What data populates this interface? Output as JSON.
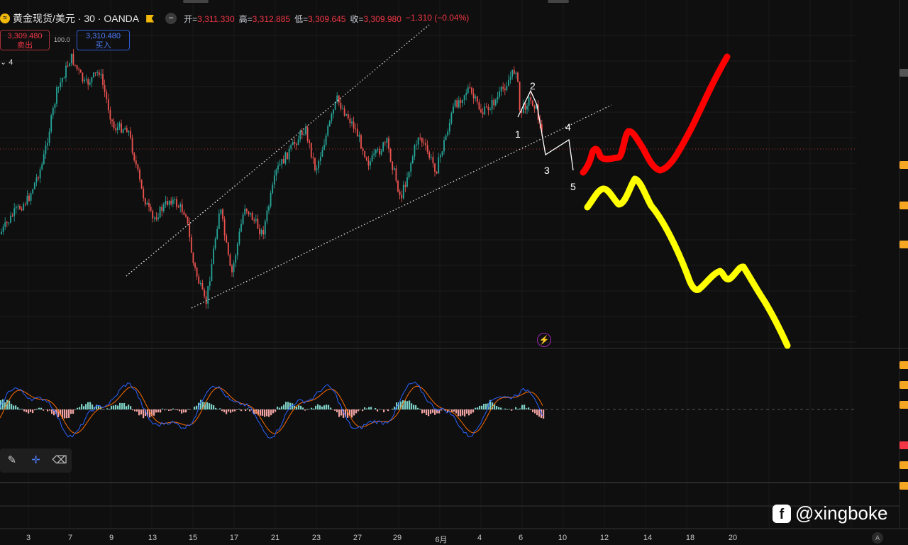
{
  "header": {
    "symbol_title": "黄金现货/美元 · 30 · OANDA",
    "collapse_label": "−",
    "ohlc": [
      {
        "label": "开=",
        "value": "3,311.330"
      },
      {
        "label": "高=",
        "value": "3,312.885"
      },
      {
        "label": "低=",
        "value": "3,309.645"
      },
      {
        "label": "收=",
        "value": "3,309.980"
      },
      {
        "label": "",
        "value": "−1.310 (−0.04%)"
      }
    ]
  },
  "trade": {
    "sell_price": "3,309.480",
    "sell_label": "卖出",
    "spread": "100.0",
    "buy_price": "3,310.480",
    "buy_label": "买入"
  },
  "indicator_toggle": "⌄ 4",
  "wave_labels": [
    "1",
    "2",
    "3",
    "4",
    "5"
  ],
  "x_axis_labels": [
    "3",
    "7",
    "9",
    "13",
    "15",
    "17",
    "21",
    "23",
    "27",
    "29",
    "6月",
    "4",
    "6",
    "10",
    "12",
    "14",
    "18",
    "20"
  ],
  "auto_button": "A",
  "watermark": "@xingboke",
  "colors": {
    "background": "#0f0f0f",
    "up_candle": "#26a69a",
    "down_candle": "#ef5350",
    "bullish_path": "#ff0000",
    "bearish_path": "#ffff00",
    "macd_line": "#2962ff",
    "signal_line": "#ff6d00"
  },
  "icons": {
    "symbol": "gold-coin-icon",
    "flag": "flag-icon",
    "bolt": "lightning-icon",
    "draw": "brush-icon",
    "crosshair": "crosshair-icon",
    "eraser": "eraser-icon",
    "watermark": "facebook-icon"
  }
}
